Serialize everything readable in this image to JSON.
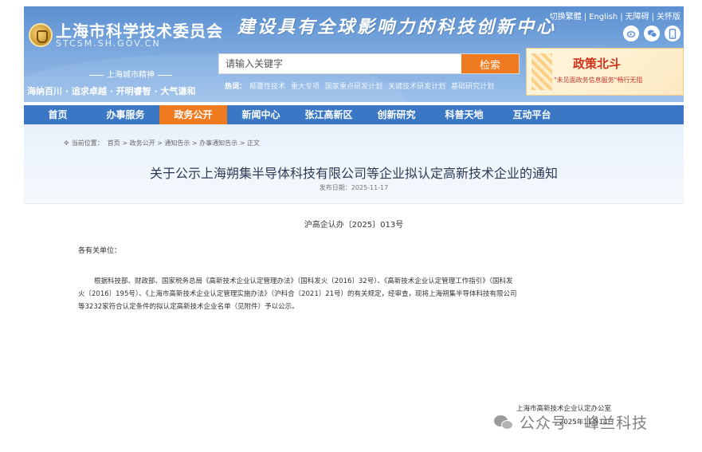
{
  "header": {
    "site_title": "上海市科学技术委员会",
    "site_domain": "STCSM.SH.GOV.CN",
    "slogan": "建设具有全球影响力的科技创新中心",
    "spirit_label": "上海城市精神",
    "spirit_text": "海纳百川 · 追求卓越 · 开明睿智 · 大气谦和",
    "top_links": [
      "切换繁體",
      "English",
      "无障碍",
      "关怀版"
    ],
    "social_icons": [
      "weibo-icon",
      "wechat-icon",
      "mobile-icon"
    ]
  },
  "search": {
    "placeholder": "请输入关键字",
    "button_label": "检索",
    "hot_label": "热词：",
    "hot_words": [
      "颠覆性技术",
      "重大专项",
      "国家重点研发计划",
      "关键技术研发计划",
      "基础研究计划"
    ]
  },
  "promo": {
    "title": "政策北斗",
    "subtitle": "\"未见面政务信息服务\"畅行无阻"
  },
  "nav": {
    "items": [
      "首页",
      "办事服务",
      "政务公开",
      "新闻中心",
      "张江高新区",
      "创新研究",
      "科普天地",
      "互动平台"
    ],
    "active_index": 2
  },
  "breadcrumb": {
    "label": "当前位置：",
    "path": "首页 > 政务公开 > 通知告示 > 办事通知告示 > 正文"
  },
  "article": {
    "title": "关于公示上海朔集半导体科技有限公司等企业拟认定高新技术企业的通知",
    "publish_date": "发布日期：2025-11-17",
    "doc_number": "沪高企认办〔2025〕013号",
    "addressee": "各有关单位：",
    "body_lines": [
      "根据科技部、财政部、国家税务总局《高新技术企业认定管理办法》（国科发火〔2016〕32号）、《高新技术企业认定管理工作指引》（国科发",
      "火〔2016〕195号）、《上海市高新技术企业认定管理实施办法》（沪科合〔2021〕21号）的有关规定，经审查，现将上海朔集半导体科技有限公司",
      "等3232家符合认定条件的拟认定高新技术企业名单（见附件）予以公示。"
    ],
    "signature_org": "上海市高新技术企业认定办公室",
    "signature_date": "2025年11月14日"
  },
  "watermark": {
    "text": "公众号 · 峰兰科技"
  }
}
